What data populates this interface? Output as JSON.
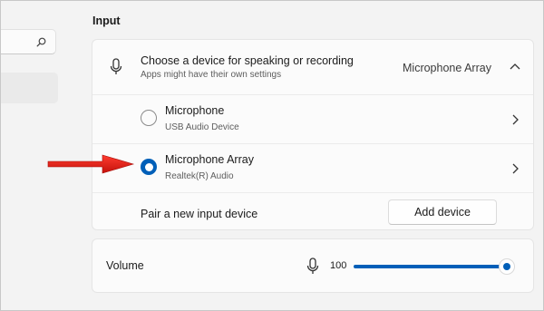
{
  "search": {
    "icon": "search-icon"
  },
  "input_section": {
    "title": "Input",
    "device_chooser": {
      "title": "Choose a device for speaking or recording",
      "subtitle": "Apps might have their own settings",
      "selected_value": "Microphone Array",
      "expanded": true
    },
    "devices": [
      {
        "name": "Microphone",
        "detail": "USB Audio Device",
        "selected": false
      },
      {
        "name": "Microphone Array",
        "detail": "Realtek(R) Audio",
        "selected": true
      }
    ],
    "pair": {
      "label": "Pair a new input device",
      "button_label": "Add device"
    }
  },
  "volume": {
    "label": "Volume",
    "value": "100",
    "level_percent": 100
  },
  "colors": {
    "accent": "#005fb8",
    "annotation_arrow": "#e8221b"
  }
}
